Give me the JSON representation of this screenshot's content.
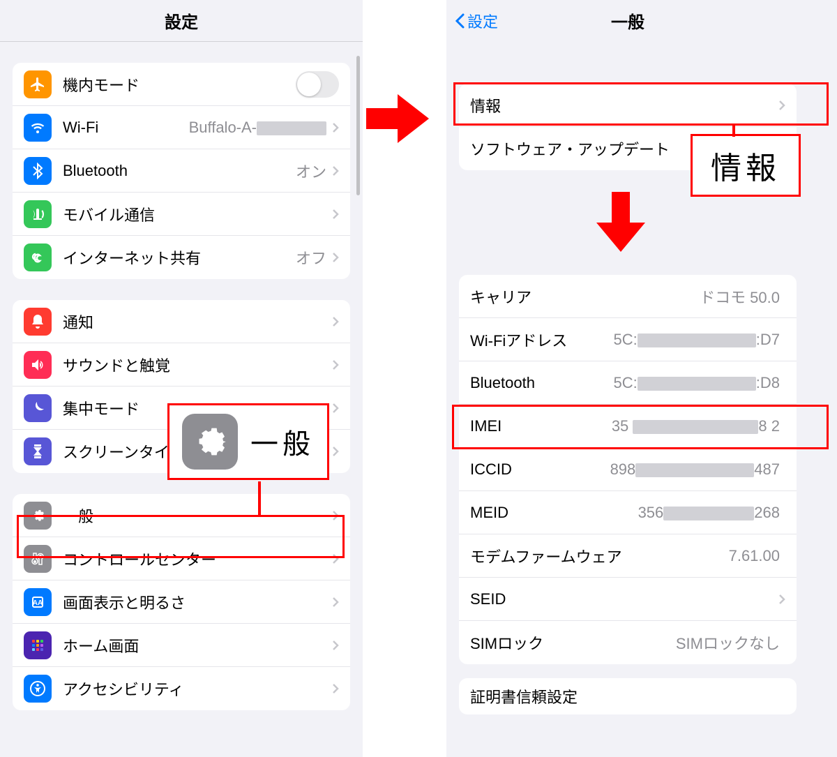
{
  "left": {
    "title": "設定",
    "groups": [
      {
        "rows": [
          {
            "key": "airplane",
            "label": "機内モード",
            "toggle": true,
            "iconColor": "#ff9500"
          },
          {
            "key": "wifi",
            "label": "Wi-Fi",
            "value": "Buffalo-A-",
            "redact_after": 100,
            "chevron": true,
            "iconColor": "#007aff"
          },
          {
            "key": "bluetooth",
            "label": "Bluetooth",
            "value": "オン",
            "chevron": true,
            "iconColor": "#007aff"
          },
          {
            "key": "cellular",
            "label": "モバイル通信",
            "chevron": true,
            "iconColor": "#34c759"
          },
          {
            "key": "hotspot",
            "label": "インターネット共有",
            "value": "オフ",
            "chevron": true,
            "iconColor": "#34c759"
          }
        ]
      },
      {
        "rows": [
          {
            "key": "notify",
            "label": "通知",
            "chevron": true,
            "iconColor": "#ff3b30"
          },
          {
            "key": "sound",
            "label": "サウンドと触覚",
            "chevron": true,
            "iconColor": "#ff2d55"
          },
          {
            "key": "focus",
            "label": "集中モード",
            "chevron": true,
            "iconColor": "#5856d6"
          },
          {
            "key": "screentime",
            "label": "スクリーンタイム",
            "chevron": true,
            "iconColor": "#5856d6"
          }
        ]
      },
      {
        "rows": [
          {
            "key": "general",
            "label": "一般",
            "chevron": true,
            "iconColor": "#8e8e93"
          },
          {
            "key": "control",
            "label": "コントロールセンター",
            "chevron": true,
            "iconColor": "#8e8e93"
          },
          {
            "key": "display",
            "label": "画面表示と明るさ",
            "chevron": true,
            "iconColor": "#007aff"
          },
          {
            "key": "home",
            "label": "ホーム画面",
            "chevron": true,
            "iconColor": "#5200d2"
          },
          {
            "key": "accessibility",
            "label": "アクセシビリティ",
            "chevron": true,
            "iconColor": "#007aff"
          }
        ]
      }
    ],
    "callout_label": "一般"
  },
  "right": {
    "back_label": "設定",
    "title": "一般",
    "group1": [
      {
        "key": "about",
        "label": "情報",
        "chevron": true
      },
      {
        "key": "swupdate",
        "label": "ソフトウェア・アップデート",
        "chevron": true
      }
    ],
    "info_block": [
      {
        "key": "carrier",
        "label": "キャリア",
        "value": "ドコモ 50.0"
      },
      {
        "key": "wifiaddr",
        "label": "Wi-Fiアドレス",
        "value_pre": "5C:",
        "redact_mid": 170,
        "value_post": ":D7"
      },
      {
        "key": "btaddr",
        "label": "Bluetooth",
        "value_pre": "5C:",
        "redact_mid": 170,
        "value_post": ":D8"
      },
      {
        "key": "imei",
        "label": "IMEI",
        "value_pre": "35 ",
        "redact_mid": 180,
        "value_post": "8 2"
      },
      {
        "key": "iccid",
        "label": "ICCID",
        "value_pre": "898",
        "redact_mid": 170,
        "value_post": "487"
      },
      {
        "key": "meid",
        "label": "MEID",
        "value_pre": "356",
        "redact_mid": 130,
        "value_post": "268"
      },
      {
        "key": "modem",
        "label": "モデムファームウェア",
        "value": "7.61.00"
      },
      {
        "key": "seid",
        "label": "SEID",
        "chevron": true
      },
      {
        "key": "simlock",
        "label": "SIMロック",
        "value": "SIMロックなし"
      }
    ],
    "trailing_label": "証明書信頼設定",
    "callout_label": "情報"
  }
}
